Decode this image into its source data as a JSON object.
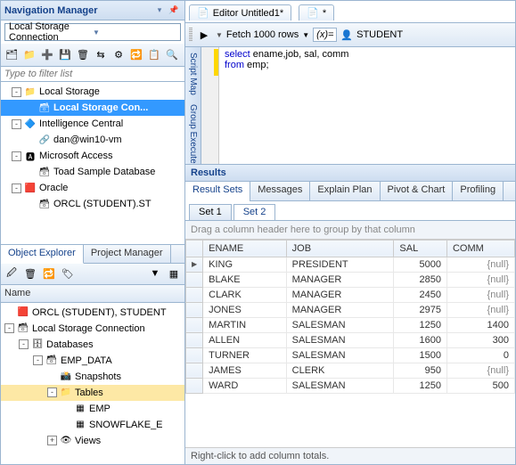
{
  "nav": {
    "title": "Navigation Manager",
    "connection": "Local Storage Connection",
    "filter_placeholder": "Type to filter list",
    "tree": [
      {
        "exp": "-",
        "indent": 12,
        "icon": "📁",
        "label": "Local Storage"
      },
      {
        "exp": "",
        "indent": 28,
        "icon": "🗃",
        "label": "Local Storage Con...",
        "sel": true
      },
      {
        "exp": "-",
        "indent": 12,
        "icon": "🔷",
        "label": "Intelligence Central"
      },
      {
        "exp": "",
        "indent": 28,
        "icon": "🔗",
        "label": "dan@win10-vm"
      },
      {
        "exp": "-",
        "indent": 12,
        "icon": "🅰",
        "label": "Microsoft Access"
      },
      {
        "exp": "",
        "indent": 28,
        "icon": "🗃",
        "label": "Toad Sample Database"
      },
      {
        "exp": "-",
        "indent": 12,
        "icon": "🟥",
        "label": "Oracle"
      },
      {
        "exp": "",
        "indent": 28,
        "icon": "🗃",
        "label": "ORCL (STUDENT).ST"
      }
    ]
  },
  "obj_tabs": {
    "a": "Object Explorer",
    "b": "Project Manager"
  },
  "name_header": "Name",
  "obj_tree": [
    {
      "exp": "",
      "indent": 4,
      "icon": "🟥",
      "label": "ORCL (STUDENT), STUDENT"
    },
    {
      "exp": "-",
      "indent": 4,
      "icon": "🗃",
      "label": "Local Storage Connection"
    },
    {
      "exp": "-",
      "indent": 20,
      "icon": "🗄",
      "label": "Databases"
    },
    {
      "exp": "-",
      "indent": 36,
      "icon": "🗃",
      "label": "EMP_DATA"
    },
    {
      "exp": "",
      "indent": 52,
      "icon": "📸",
      "label": "Snapshots"
    },
    {
      "exp": "-",
      "indent": 52,
      "icon": "📁",
      "label": "Tables",
      "sel2": true
    },
    {
      "exp": "",
      "indent": 68,
      "icon": "▦",
      "label": "EMP"
    },
    {
      "exp": "",
      "indent": 68,
      "icon": "▦",
      "label": "SNOWFLAKE_E"
    },
    {
      "exp": "+",
      "indent": 52,
      "icon": "👁",
      "label": "Views"
    }
  ],
  "editor": {
    "tab_label": "Editor Untitled1*",
    "new_tab": "*",
    "fetch_label": "Fetch 1000 rows",
    "fx": "(x)=",
    "user": "STUDENT",
    "sql_line1_kw": "select",
    "sql_line1_rest": " ename,job, sal, comm",
    "sql_line2_kw": "from",
    "sql_line2_rest": " emp;"
  },
  "vbar": {
    "a": "Script Map",
    "b": "Group Execute"
  },
  "results": {
    "title": "Results",
    "tabs": [
      "Result Sets",
      "Messages",
      "Explain Plan",
      "Pivot & Chart",
      "Profiling"
    ],
    "sets": [
      "Set 1",
      "Set 2"
    ],
    "group_hint": "Drag a column header here to group by that column",
    "cols": [
      "ENAME",
      "JOB",
      "SAL",
      "COMM"
    ],
    "rows": [
      {
        "ind": "▶",
        "c": [
          "KING",
          "PRESIDENT",
          "5000",
          "{null}"
        ]
      },
      {
        "ind": "",
        "c": [
          "BLAKE",
          "MANAGER",
          "2850",
          "{null}"
        ]
      },
      {
        "ind": "",
        "c": [
          "CLARK",
          "MANAGER",
          "2450",
          "{null}"
        ]
      },
      {
        "ind": "",
        "c": [
          "JONES",
          "MANAGER",
          "2975",
          "{null}"
        ]
      },
      {
        "ind": "",
        "c": [
          "MARTIN",
          "SALESMAN",
          "1250",
          "1400"
        ]
      },
      {
        "ind": "",
        "c": [
          "ALLEN",
          "SALESMAN",
          "1600",
          "300"
        ]
      },
      {
        "ind": "",
        "c": [
          "TURNER",
          "SALESMAN",
          "1500",
          "0"
        ]
      },
      {
        "ind": "",
        "c": [
          "JAMES",
          "CLERK",
          "950",
          "{null}"
        ]
      },
      {
        "ind": "",
        "c": [
          "WARD",
          "SALESMAN",
          "1250",
          "500"
        ]
      }
    ],
    "footer": "Right-click to add column totals."
  }
}
